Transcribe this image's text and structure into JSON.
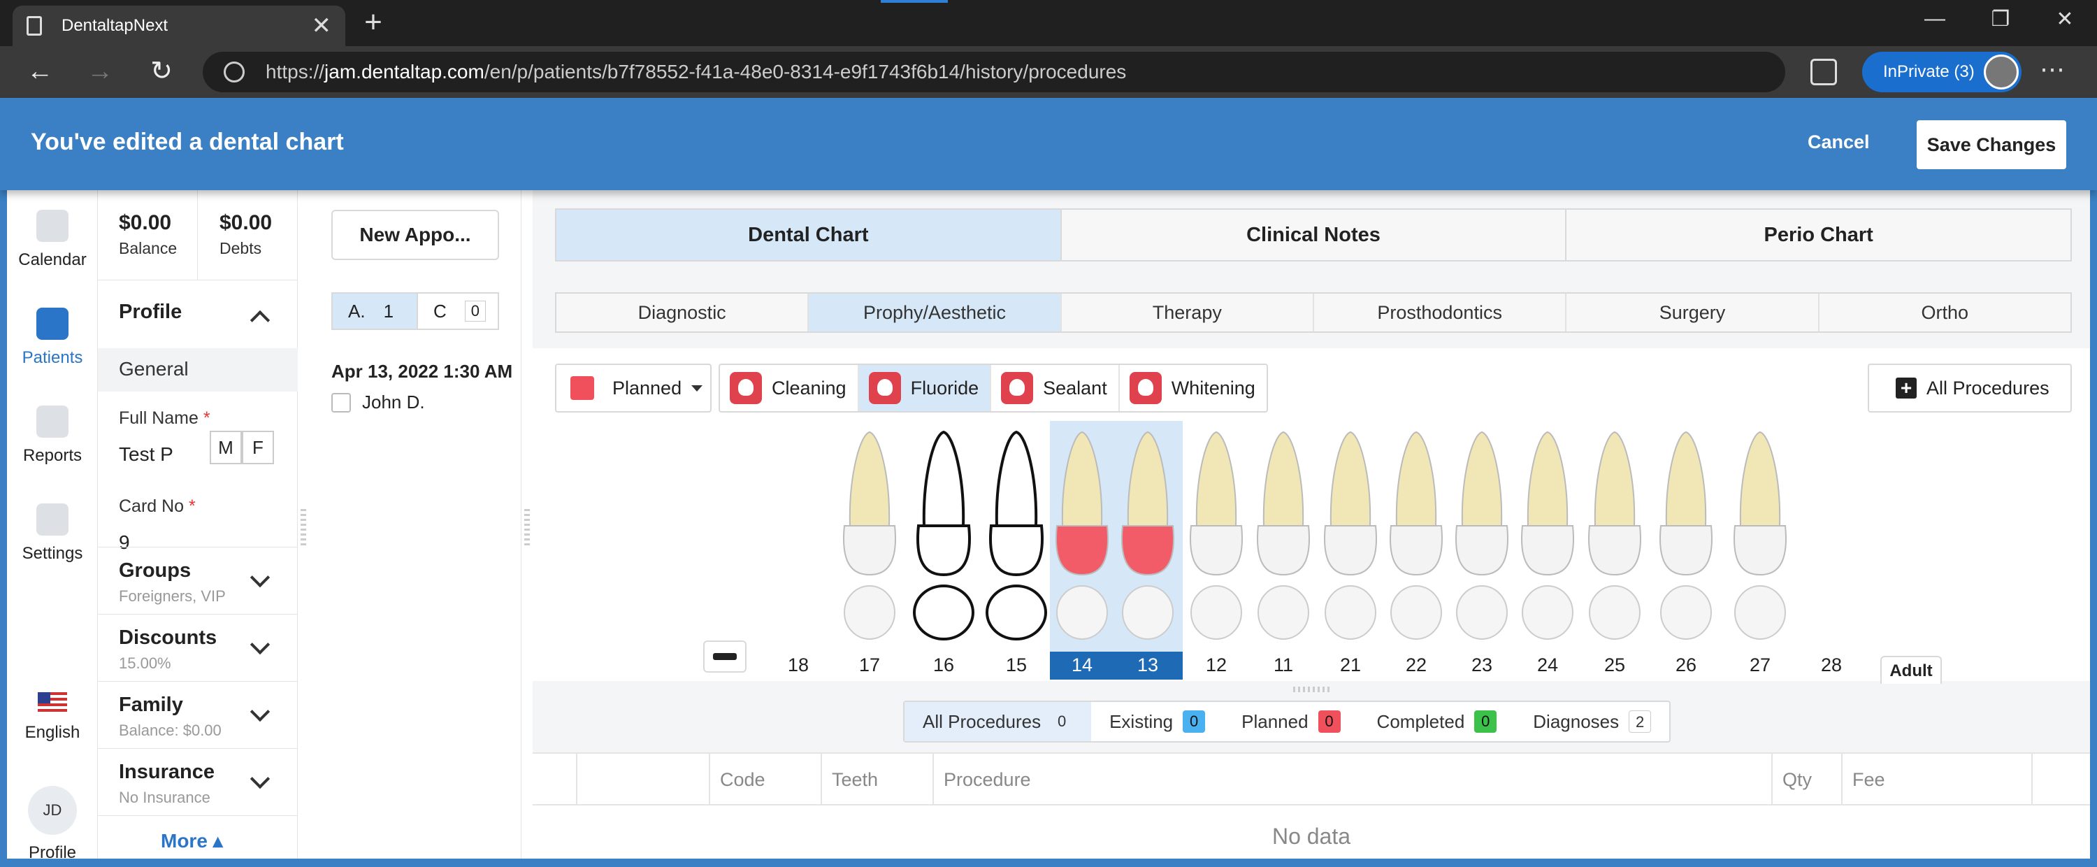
{
  "browser": {
    "tab_title": "DentaltapNext",
    "url_prefix": "https://",
    "url_host": "jam.dentaltap.com",
    "url_path": "/en/p/patients/b7f78552-f41a-48e0-8314-e9f1743f6b14/history/procedures",
    "inprivate_label": "InPrivate (3)"
  },
  "banner": {
    "title": "You've edited a dental chart",
    "cancel_label": "Cancel",
    "save_label": "Save Changes"
  },
  "leftnav": {
    "items": [
      {
        "label": "Calendar",
        "icon": "calendar-icon"
      },
      {
        "label": "Patients",
        "icon": "patients-icon"
      },
      {
        "label": "Reports",
        "icon": "reports-icon"
      },
      {
        "label": "Settings",
        "icon": "gear-icon"
      }
    ],
    "language": "English",
    "profile_initials": "JD",
    "profile_label": "Profile"
  },
  "patient": {
    "balance_value": "$0.00",
    "balance_label": "Balance",
    "debts_value": "$0.00",
    "debts_label": "Debts",
    "profile_title": "Profile",
    "general_label": "General",
    "fullname_label": "Full Name",
    "fullname_value": "Test P",
    "gender_m": "M",
    "gender_f": "F",
    "cardno_label": "Card No",
    "cardno_value": "9",
    "groups_title": "Groups",
    "groups_sub": "Foreigners, VIP",
    "discounts_title": "Discounts",
    "discounts_sub": "15.00%",
    "family_title": "Family",
    "family_sub": "Balance: $0.00",
    "insurance_title": "Insurance",
    "insurance_sub": "No Insurance",
    "more_label": "More"
  },
  "appointments": {
    "new_label": "New Appo...",
    "a_label": "A.",
    "a_count": "1",
    "c_label": "C",
    "c_count": "0",
    "date": "Apr 13, 2022 1:30 AM",
    "person": "John D."
  },
  "main": {
    "tabs": [
      "Dental Chart",
      "Clinical Notes",
      "Perio Chart"
    ],
    "active_tab": "Dental Chart",
    "subtabs": [
      "Diagnostic",
      "Prophy/Aesthetic",
      "Therapy",
      "Prosthodontics",
      "Surgery",
      "Ortho"
    ],
    "active_subtab": "Prophy/Aesthetic",
    "status_label": "Planned",
    "procedures": [
      "Cleaning",
      "Fluoride",
      "Sealant",
      "Whitening"
    ],
    "active_procedure": "Fluoride",
    "all_procedures_label": "All Procedures",
    "tooth_numbers": [
      "18",
      "17",
      "16",
      "15",
      "14",
      "13",
      "12",
      "11",
      "21",
      "22",
      "23",
      "24",
      "25",
      "26",
      "27",
      "28"
    ],
    "selected_teeth": [
      "14",
      "13"
    ],
    "adult_label": "Adult",
    "filters": [
      {
        "label": "All Procedures",
        "count": "0"
      },
      {
        "label": "Existing",
        "count": "0"
      },
      {
        "label": "Planned",
        "count": "0"
      },
      {
        "label": "Completed",
        "count": "0"
      },
      {
        "label": "Diagnoses",
        "count": "2"
      }
    ],
    "columns": [
      "Code",
      "Teeth",
      "Procedure",
      "Qty",
      "Fee"
    ],
    "empty_text": "No data"
  },
  "colors": {
    "accent": "#3b7fc4",
    "planned": "#f0505c",
    "existing": "#4ab1f0",
    "completed": "#3cc24a",
    "selected_tooth": "#1f6ab5"
  }
}
